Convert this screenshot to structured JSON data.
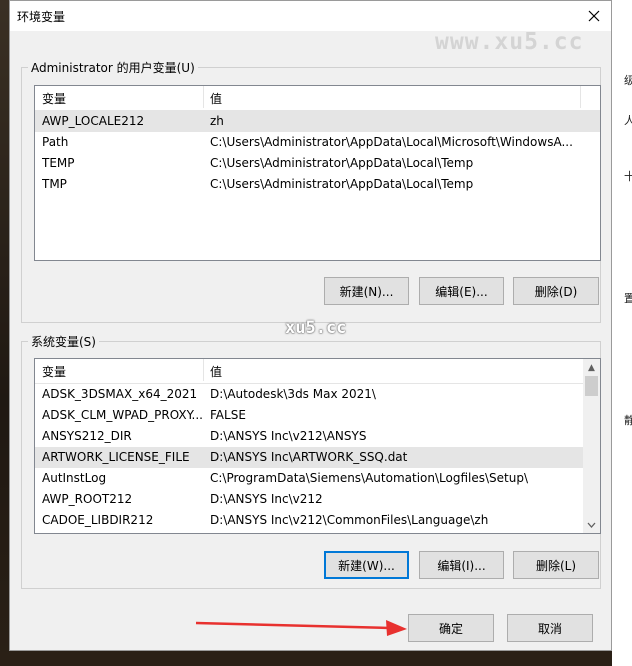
{
  "dialog": {
    "title": "环境变量"
  },
  "watermarks": [
    "www.xu5.cc",
    "xu5.cc"
  ],
  "background_fragments": [
    "级",
    "人",
    "十",
    "置",
    "静"
  ],
  "user_vars": {
    "group_label": "Administrator 的用户变量(U)",
    "col_name": "变量",
    "col_value": "值",
    "rows": [
      {
        "name": "AWP_LOCALE212",
        "value": "zh",
        "selected": true
      },
      {
        "name": "Path",
        "value": "C:\\Users\\Administrator\\AppData\\Local\\Microsoft\\WindowsA..."
      },
      {
        "name": "TEMP",
        "value": "C:\\Users\\Administrator\\AppData\\Local\\Temp"
      },
      {
        "name": "TMP",
        "value": "C:\\Users\\Administrator\\AppData\\Local\\Temp"
      }
    ],
    "btn_new": "新建(N)...",
    "btn_edit": "编辑(E)...",
    "btn_delete": "删除(D)"
  },
  "system_vars": {
    "group_label": "系统变量(S)",
    "col_name": "变量",
    "col_value": "值",
    "rows": [
      {
        "name": "ADSK_3DSMAX_x64_2021",
        "value": "D:\\Autodesk\\3ds Max 2021\\"
      },
      {
        "name": "ADSK_CLM_WPAD_PROXY...",
        "value": "FALSE"
      },
      {
        "name": "ANSYS212_DIR",
        "value": "D:\\ANSYS Inc\\v212\\ANSYS"
      },
      {
        "name": "ARTWORK_LICENSE_FILE",
        "value": "D:\\ANSYS Inc\\ARTWORK_SSQ.dat",
        "selected": true
      },
      {
        "name": "AutInstLog",
        "value": "C:\\ProgramData\\Siemens\\Automation\\Logfiles\\Setup\\"
      },
      {
        "name": "AWP_ROOT212",
        "value": "D:\\ANSYS Inc\\v212"
      },
      {
        "name": "CADOE_LIBDIR212",
        "value": "D:\\ANSYS Inc\\v212\\CommonFiles\\Language\\zh"
      }
    ],
    "btn_new": "新建(W)...",
    "btn_edit": "编辑(I)...",
    "btn_delete": "删除(L)"
  },
  "footer": {
    "ok": "确定",
    "cancel": "取消"
  },
  "colors": {
    "accent": "#0078d7",
    "arrow": "#e8312f",
    "selected_row": "#e5e5e5"
  }
}
